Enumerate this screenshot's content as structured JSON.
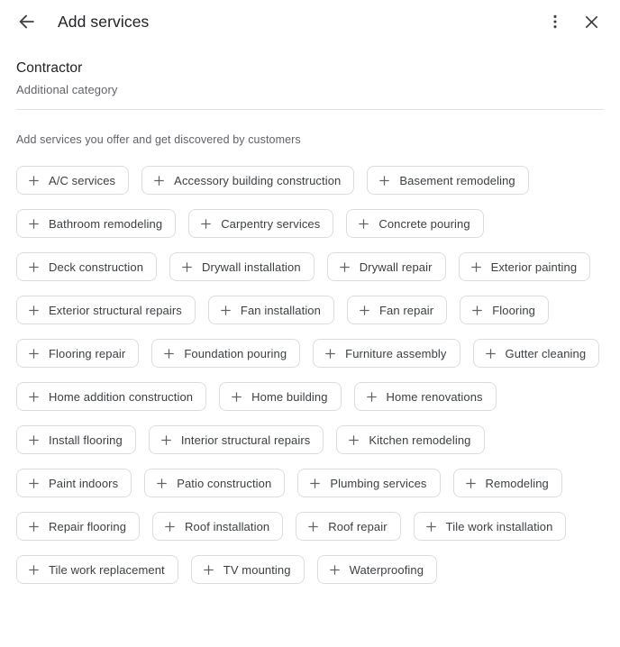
{
  "header": {
    "back_icon": "arrow-back-icon",
    "title": "Add services",
    "overflow_icon": "more-vert-icon",
    "close_icon": "close-icon"
  },
  "category": {
    "name": "Contractor",
    "subtitle": "Additional category"
  },
  "helper_text": "Add services you offer and get discovered by customers",
  "chip_icon": "plus-icon",
  "services": [
    "A/C services",
    "Accessory building construction",
    "Basement remodeling",
    "Bathroom remodeling",
    "Carpentry services",
    "Concrete pouring",
    "Deck construction",
    "Drywall installation",
    "Drywall repair",
    "Exterior painting",
    "Exterior structural repairs",
    "Fan installation",
    "Fan repair",
    "Flooring",
    "Flooring repair",
    "Foundation pouring",
    "Furniture assembly",
    "Gutter cleaning",
    "Home addition construction",
    "Home building",
    "Home renovations",
    "Install flooring",
    "Interior structural repairs",
    "Kitchen remodeling",
    "Paint indoors",
    "Patio construction",
    "Plumbing services",
    "Remodeling",
    "Repair flooring",
    "Roof installation",
    "Roof repair",
    "Tile work installation",
    "Tile work replacement",
    "TV mounting",
    "Waterproofing"
  ],
  "colors": {
    "text_primary": "#202124",
    "text_secondary": "#5f6368",
    "chip_border": "#dadce0",
    "divider": "#e3e3e3",
    "background": "#ffffff"
  }
}
